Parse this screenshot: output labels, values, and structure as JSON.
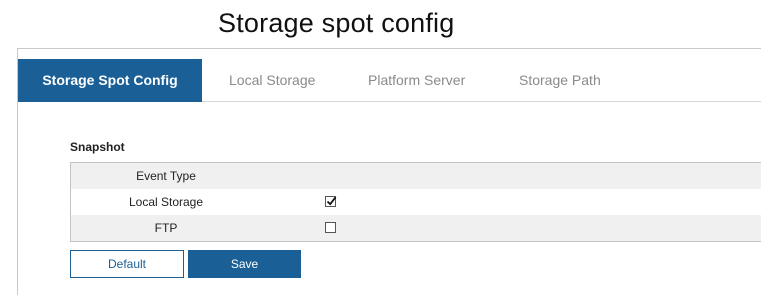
{
  "page": {
    "title": "Storage spot config"
  },
  "tabs": [
    {
      "label": "Storage Spot Config",
      "active": true
    },
    {
      "label": "Local Storage",
      "active": false
    },
    {
      "label": "Platform Server",
      "active": false
    },
    {
      "label": "Storage Path",
      "active": false
    }
  ],
  "snapshot": {
    "section_title": "Snapshot",
    "header": "Event Type",
    "rows": [
      {
        "label": "Local Storage",
        "checked": true
      },
      {
        "label": "FTP",
        "checked": false
      }
    ]
  },
  "buttons": {
    "default_label": "Default",
    "save_label": "Save"
  },
  "colors": {
    "accent": "#1a5f96",
    "row_shade": "#f0f0f0"
  }
}
